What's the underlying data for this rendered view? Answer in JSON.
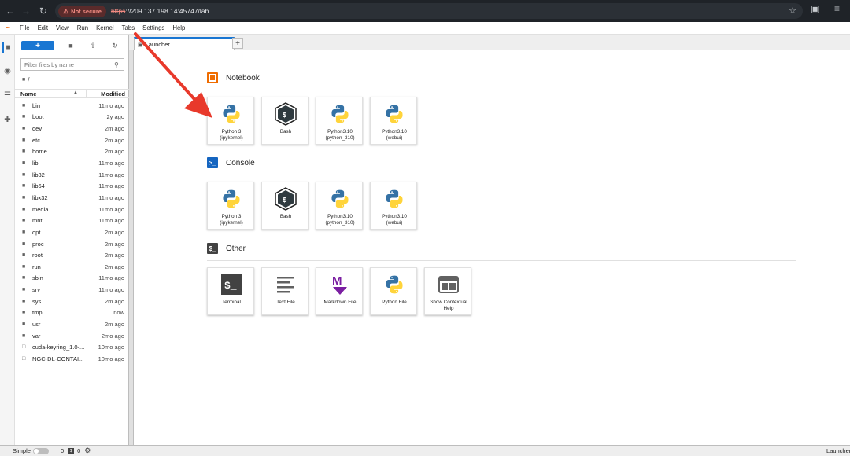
{
  "browser": {
    "security_label": "Not secure",
    "url_scheme": "https",
    "url_rest": "://209.137.198.14:45747/lab"
  },
  "menubar": {
    "items": [
      "File",
      "Edit",
      "View",
      "Run",
      "Kernel",
      "Tabs",
      "Settings",
      "Help"
    ]
  },
  "filebrowser": {
    "new_label": "+",
    "filter_placeholder": "Filter files by name",
    "breadcrumb": "/",
    "col_name": "Name",
    "col_modified": "Modified",
    "files": [
      {
        "name": "bin",
        "modified": "11mo ago",
        "type": "folder"
      },
      {
        "name": "boot",
        "modified": "2y ago",
        "type": "folder"
      },
      {
        "name": "dev",
        "modified": "2m ago",
        "type": "folder"
      },
      {
        "name": "etc",
        "modified": "2m ago",
        "type": "folder"
      },
      {
        "name": "home",
        "modified": "2m ago",
        "type": "folder"
      },
      {
        "name": "lib",
        "modified": "11mo ago",
        "type": "folder"
      },
      {
        "name": "lib32",
        "modified": "11mo ago",
        "type": "folder"
      },
      {
        "name": "lib64",
        "modified": "11mo ago",
        "type": "folder"
      },
      {
        "name": "libx32",
        "modified": "11mo ago",
        "type": "folder"
      },
      {
        "name": "media",
        "modified": "11mo ago",
        "type": "folder"
      },
      {
        "name": "mnt",
        "modified": "11mo ago",
        "type": "folder"
      },
      {
        "name": "opt",
        "modified": "2m ago",
        "type": "folder"
      },
      {
        "name": "proc",
        "modified": "2m ago",
        "type": "folder"
      },
      {
        "name": "root",
        "modified": "2m ago",
        "type": "folder"
      },
      {
        "name": "run",
        "modified": "2m ago",
        "type": "folder"
      },
      {
        "name": "sbin",
        "modified": "11mo ago",
        "type": "folder"
      },
      {
        "name": "srv",
        "modified": "11mo ago",
        "type": "folder"
      },
      {
        "name": "sys",
        "modified": "2m ago",
        "type": "folder"
      },
      {
        "name": "tmp",
        "modified": "now",
        "type": "folder"
      },
      {
        "name": "usr",
        "modified": "2m ago",
        "type": "folder"
      },
      {
        "name": "var",
        "modified": "2mo ago",
        "type": "folder"
      },
      {
        "name": "cuda-keyring_1.0-...",
        "modified": "10mo ago",
        "type": "file"
      },
      {
        "name": "NGC-DL-CONTAI...",
        "modified": "10mo ago",
        "type": "file"
      }
    ]
  },
  "tabs": {
    "active_label": "Launcher"
  },
  "launcher": {
    "sections": [
      {
        "title": "Notebook",
        "icon": "notebook-icon",
        "cards": [
          {
            "label": "Python 3\n(ipykernel)",
            "icon": "python-icon"
          },
          {
            "label": "Bash",
            "icon": "bash-icon"
          },
          {
            "label": "Python3.10\n(python_310)",
            "icon": "python-icon"
          },
          {
            "label": "Python3.10\n(webui)",
            "icon": "python-icon"
          }
        ]
      },
      {
        "title": "Console",
        "icon": "console-icon",
        "cards": [
          {
            "label": "Python 3\n(ipykernel)",
            "icon": "python-icon"
          },
          {
            "label": "Bash",
            "icon": "bash-icon"
          },
          {
            "label": "Python3.10\n(python_310)",
            "icon": "python-icon"
          },
          {
            "label": "Python3.10\n(webui)",
            "icon": "python-icon"
          }
        ]
      },
      {
        "title": "Other",
        "icon": "terminal-icon",
        "cards": [
          {
            "label": "Terminal",
            "icon": "terminal-icon"
          },
          {
            "label": "Text File",
            "icon": "text-file-icon"
          },
          {
            "label": "Markdown File",
            "icon": "markdown-icon"
          },
          {
            "label": "Python File",
            "icon": "python-icon"
          },
          {
            "label": "Show Contextual\nHelp",
            "icon": "contextual-help-icon"
          }
        ]
      }
    ]
  },
  "statusbar": {
    "simple_label": "Simple",
    "kernels_count": "0",
    "terminals_count": "0",
    "right_label": "Launcher"
  },
  "colors": {
    "accent": "#1976d2",
    "annotation_arrow": "#e8392b",
    "notebook_orange": "#ef6c00",
    "console_blue": "#1565c0"
  }
}
